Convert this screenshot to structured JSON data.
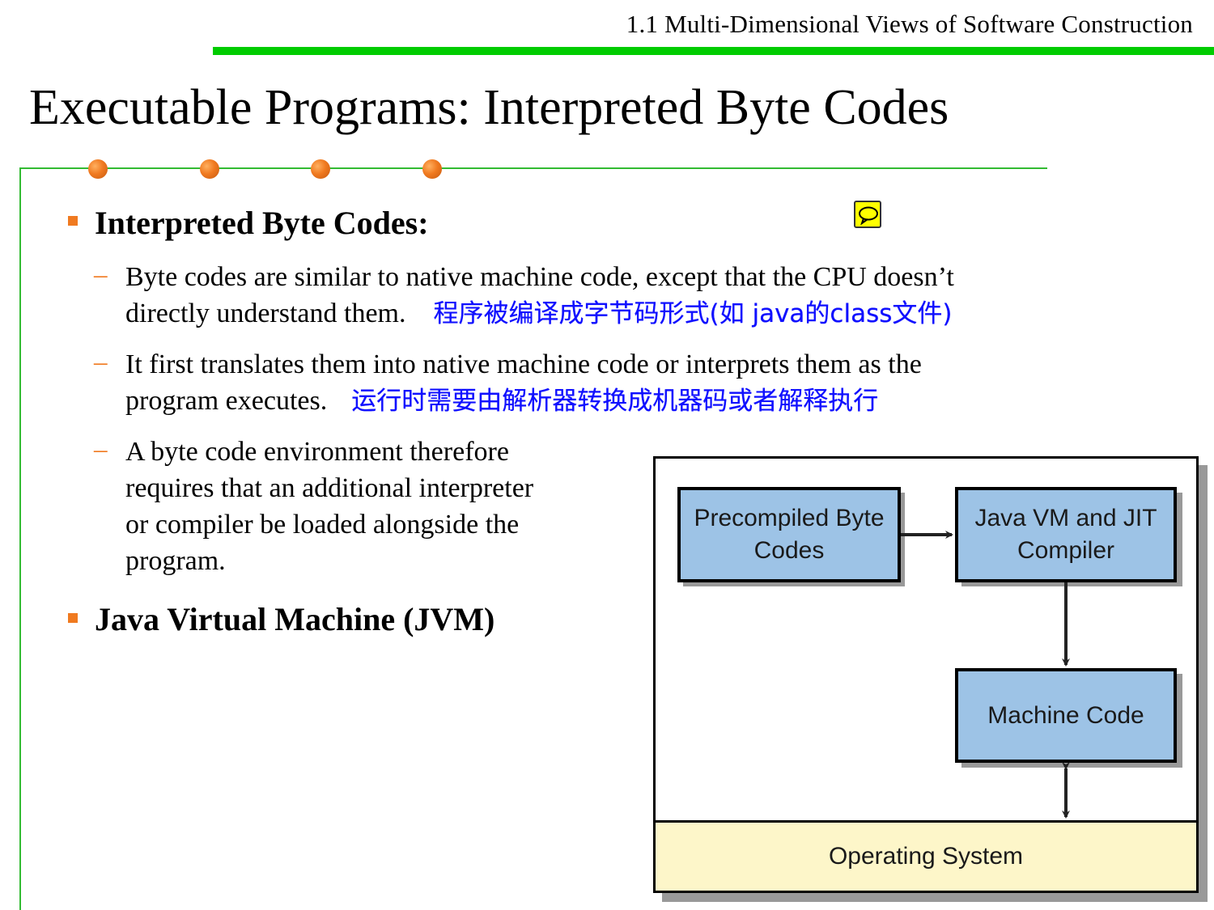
{
  "header": {
    "section": "1.1 Multi-Dimensional Views of Software Construction"
  },
  "title": "Executable Programs: Interpreted Byte Codes",
  "accent_colors": {
    "green": "#00cc00",
    "orange": "#f07a20",
    "chinese_text": "#1010ff"
  },
  "icons": {
    "note": "comment-note-icon"
  },
  "bullets": [
    {
      "label": "Interpreted Byte Codes:",
      "subitems": [
        {
          "lines": [
            "Byte codes are similar to native machine code, except that the CPU doesn’t",
            "directly understand them."
          ],
          "note_zh": "程序被编译成字节码形式(如 java的class文件)"
        },
        {
          "lines": [
            "It first translates them into native machine code or interprets them as the",
            "program executes."
          ],
          "note_zh": "运行时需要由解析器转换成机器码或者解释执行"
        },
        {
          "lines": [
            "A byte code environment therefore",
            "requires that an additional interpreter",
            "or compiler be loaded alongside the",
            "program."
          ]
        }
      ]
    },
    {
      "label": "Java Virtual Machine (JVM)"
    }
  ],
  "diagram": {
    "boxes": {
      "bytecodes": "Precompiled Byte Codes",
      "jvm": "Java VM and JIT Compiler",
      "machine": "Machine Code"
    },
    "os": "Operating System",
    "colors": {
      "box_fill": "#9dc3e6",
      "os_fill": "#fdf6c9"
    }
  }
}
